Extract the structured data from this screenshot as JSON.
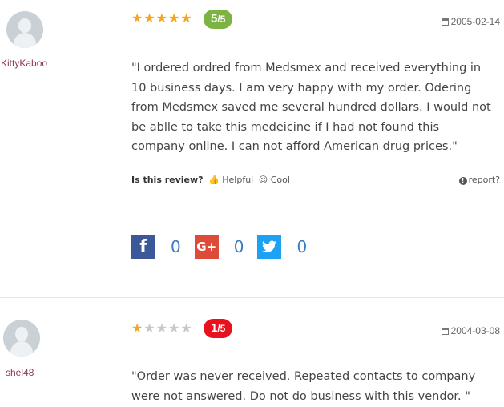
{
  "reviews": [
    {
      "username": "KittyKaboo",
      "stars_filled": 5,
      "stars_total": 5,
      "rating_num": "5",
      "rating_den": "/5",
      "badge_color": "#7cb342",
      "date": "2005-02-14",
      "text": "\"I ordered ordred from Medsmex and received everything in 10 business days. I am very happy with my order. Odering from Medsmex saved me several hundred dollars. I would not be ablle to take this medeicine if I had not found this company online. I can not afford American drug prices.\"",
      "is_review_label": "Is this review?",
      "helpful_label": "Helpful",
      "cool_label": "Cool",
      "report_label": "report?",
      "share": {
        "facebook_count": "0",
        "googleplus_count": "0",
        "twitter_count": "0"
      }
    },
    {
      "username": "shel48",
      "stars_filled": 1,
      "stars_total": 5,
      "rating_num": "1",
      "rating_den": "/5",
      "badge_color": "#e8111d",
      "date": "2004-03-08",
      "text": "\"Order was never received. Repeated contacts to company were not answered. Do not do business with this vendor. \""
    }
  ],
  "colors": {
    "facebook": "#3b5998",
    "googleplus": "#dd4b39",
    "twitter": "#1da1f2",
    "star_on": "#f5a623",
    "star_off": "#c8c8c8"
  },
  "icons": {
    "helpful": "thumbs-up-icon",
    "cool": "smile-icon",
    "report": "info-icon",
    "date": "calendar-icon"
  }
}
